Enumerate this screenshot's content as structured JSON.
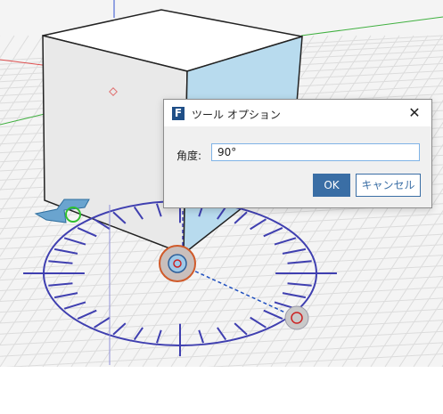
{
  "dialog": {
    "app_icon_letter": "F",
    "title": "ツール オプション",
    "close_symbol": "✕",
    "angle_label": "角度:",
    "angle_value": "90°",
    "ok_label": "OK",
    "cancel_label": "キャンセル"
  },
  "colors": {
    "dialog_accent": "#3a6ea5",
    "protractor": "#3f3fb0",
    "cube_side": "#b8dbee",
    "axis_red": "#e05050",
    "axis_green": "#40b040",
    "axis_blue": "#3050d0"
  }
}
